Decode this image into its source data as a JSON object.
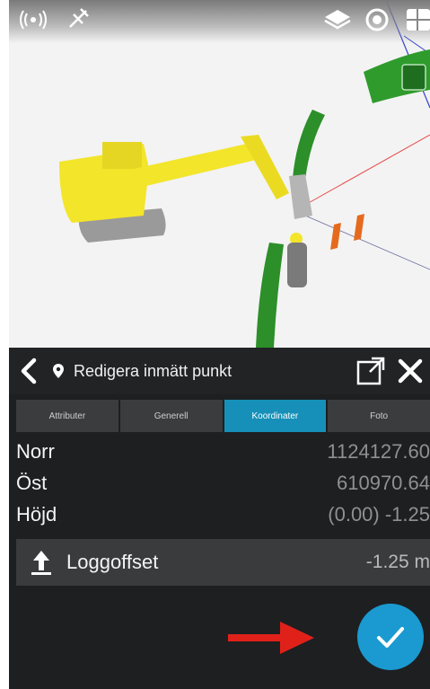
{
  "header": {
    "title": "Redigera inmätt punkt"
  },
  "tabs": [
    {
      "label": "Attributer",
      "active": false
    },
    {
      "label": "Generell",
      "active": false
    },
    {
      "label": "Koordinater",
      "active": true
    },
    {
      "label": "Foto",
      "active": false
    }
  ],
  "coordinates": [
    {
      "label": "Norr",
      "value": "1124127.60"
    },
    {
      "label": "Öst",
      "value": "610970.64"
    },
    {
      "label": "Höjd",
      "value": "(0.00) -1.25"
    }
  ],
  "offset": {
    "label": "Loggoffset",
    "value": "-1.25 m"
  },
  "icons": {
    "status_left": [
      "radio-signal-icon",
      "satellite-icon"
    ],
    "status_right": [
      "layers-icon",
      "gps-target-icon",
      "menu-icon"
    ],
    "panel": [
      "back-icon",
      "location-pin-icon",
      "external-link-icon",
      "close-icon",
      "upload-arrow-icon",
      "checkmark-icon"
    ]
  },
  "colors": {
    "accent": "#1a9ad0",
    "active_tab": "#1690b8",
    "panel_bg": "#1e1f21",
    "excavator": "#f2e52a",
    "surface": "#2f9b2c",
    "annotation_arrow": "#e0211a"
  }
}
